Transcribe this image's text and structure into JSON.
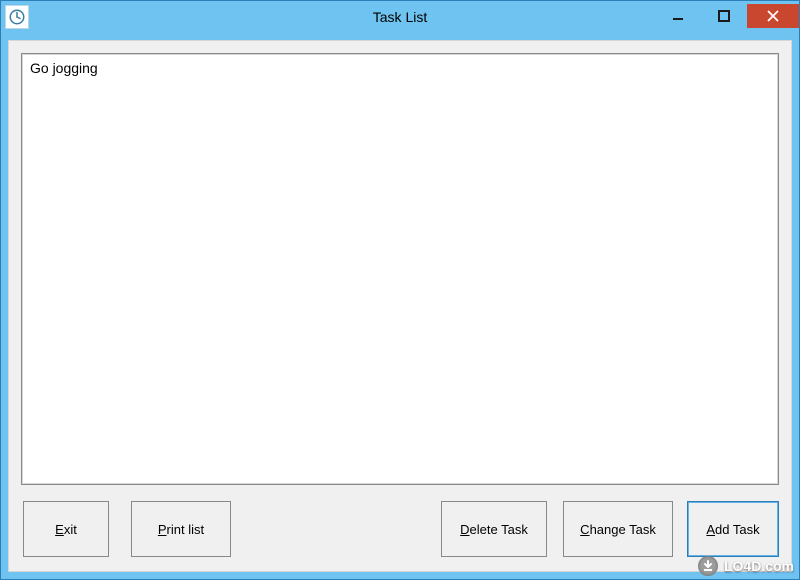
{
  "window": {
    "title": "Task List"
  },
  "list": {
    "items": [
      "Go jogging"
    ]
  },
  "buttons": {
    "exit": {
      "accel": "E",
      "rest": "xit"
    },
    "print": {
      "accel": "P",
      "rest": "rint list"
    },
    "delete": {
      "accel": "D",
      "rest": "elete Task"
    },
    "change": {
      "accel": "C",
      "rest": "hange Task"
    },
    "add": {
      "accel": "A",
      "rest": "dd Task"
    }
  },
  "watermark": {
    "text": "LO4D.com"
  }
}
